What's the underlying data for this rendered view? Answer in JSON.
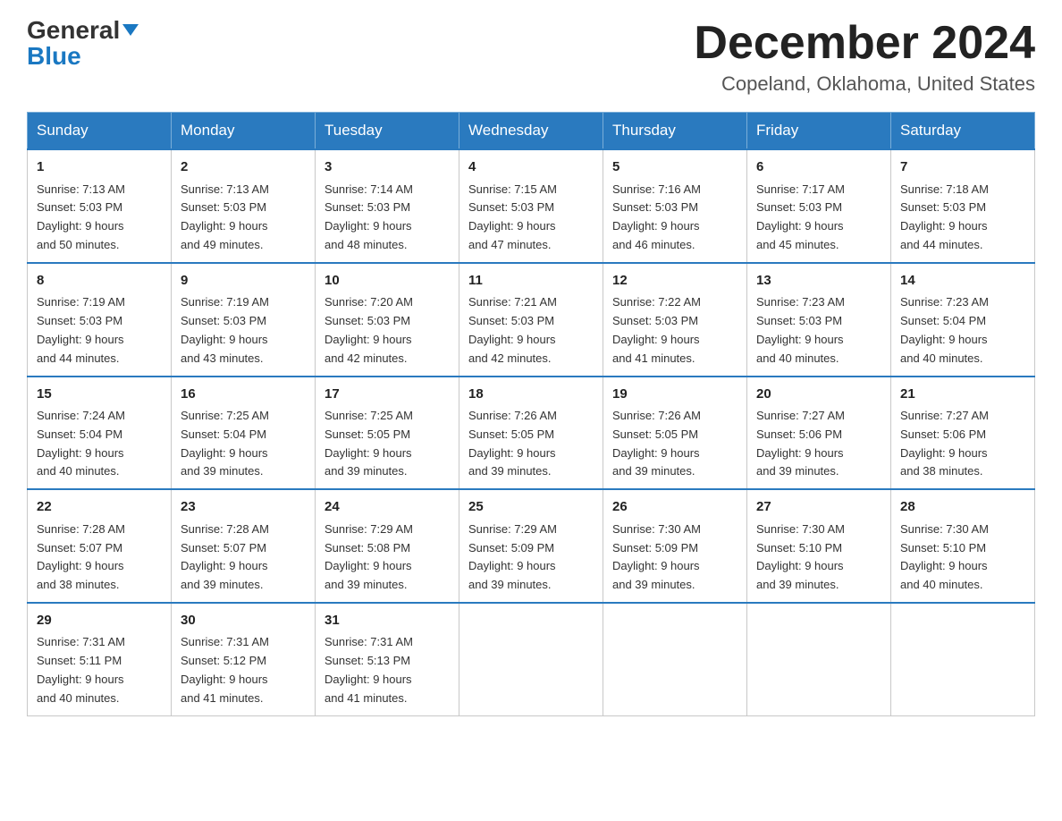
{
  "header": {
    "logo_line1": "General",
    "logo_line2": "Blue",
    "month_title": "December 2024",
    "location": "Copeland, Oklahoma, United States"
  },
  "weekdays": [
    "Sunday",
    "Monday",
    "Tuesday",
    "Wednesday",
    "Thursday",
    "Friday",
    "Saturday"
  ],
  "weeks": [
    [
      {
        "day": "1",
        "sunrise": "7:13 AM",
        "sunset": "5:03 PM",
        "daylight": "9 hours and 50 minutes."
      },
      {
        "day": "2",
        "sunrise": "7:13 AM",
        "sunset": "5:03 PM",
        "daylight": "9 hours and 49 minutes."
      },
      {
        "day": "3",
        "sunrise": "7:14 AM",
        "sunset": "5:03 PM",
        "daylight": "9 hours and 48 minutes."
      },
      {
        "day": "4",
        "sunrise": "7:15 AM",
        "sunset": "5:03 PM",
        "daylight": "9 hours and 47 minutes."
      },
      {
        "day": "5",
        "sunrise": "7:16 AM",
        "sunset": "5:03 PM",
        "daylight": "9 hours and 46 minutes."
      },
      {
        "day": "6",
        "sunrise": "7:17 AM",
        "sunset": "5:03 PM",
        "daylight": "9 hours and 45 minutes."
      },
      {
        "day": "7",
        "sunrise": "7:18 AM",
        "sunset": "5:03 PM",
        "daylight": "9 hours and 44 minutes."
      }
    ],
    [
      {
        "day": "8",
        "sunrise": "7:19 AM",
        "sunset": "5:03 PM",
        "daylight": "9 hours and 44 minutes."
      },
      {
        "day": "9",
        "sunrise": "7:19 AM",
        "sunset": "5:03 PM",
        "daylight": "9 hours and 43 minutes."
      },
      {
        "day": "10",
        "sunrise": "7:20 AM",
        "sunset": "5:03 PM",
        "daylight": "9 hours and 42 minutes."
      },
      {
        "day": "11",
        "sunrise": "7:21 AM",
        "sunset": "5:03 PM",
        "daylight": "9 hours and 42 minutes."
      },
      {
        "day": "12",
        "sunrise": "7:22 AM",
        "sunset": "5:03 PM",
        "daylight": "9 hours and 41 minutes."
      },
      {
        "day": "13",
        "sunrise": "7:23 AM",
        "sunset": "5:03 PM",
        "daylight": "9 hours and 40 minutes."
      },
      {
        "day": "14",
        "sunrise": "7:23 AM",
        "sunset": "5:04 PM",
        "daylight": "9 hours and 40 minutes."
      }
    ],
    [
      {
        "day": "15",
        "sunrise": "7:24 AM",
        "sunset": "5:04 PM",
        "daylight": "9 hours and 40 minutes."
      },
      {
        "day": "16",
        "sunrise": "7:25 AM",
        "sunset": "5:04 PM",
        "daylight": "9 hours and 39 minutes."
      },
      {
        "day": "17",
        "sunrise": "7:25 AM",
        "sunset": "5:05 PM",
        "daylight": "9 hours and 39 minutes."
      },
      {
        "day": "18",
        "sunrise": "7:26 AM",
        "sunset": "5:05 PM",
        "daylight": "9 hours and 39 minutes."
      },
      {
        "day": "19",
        "sunrise": "7:26 AM",
        "sunset": "5:05 PM",
        "daylight": "9 hours and 39 minutes."
      },
      {
        "day": "20",
        "sunrise": "7:27 AM",
        "sunset": "5:06 PM",
        "daylight": "9 hours and 39 minutes."
      },
      {
        "day": "21",
        "sunrise": "7:27 AM",
        "sunset": "5:06 PM",
        "daylight": "9 hours and 38 minutes."
      }
    ],
    [
      {
        "day": "22",
        "sunrise": "7:28 AM",
        "sunset": "5:07 PM",
        "daylight": "9 hours and 38 minutes."
      },
      {
        "day": "23",
        "sunrise": "7:28 AM",
        "sunset": "5:07 PM",
        "daylight": "9 hours and 39 minutes."
      },
      {
        "day": "24",
        "sunrise": "7:29 AM",
        "sunset": "5:08 PM",
        "daylight": "9 hours and 39 minutes."
      },
      {
        "day": "25",
        "sunrise": "7:29 AM",
        "sunset": "5:09 PM",
        "daylight": "9 hours and 39 minutes."
      },
      {
        "day": "26",
        "sunrise": "7:30 AM",
        "sunset": "5:09 PM",
        "daylight": "9 hours and 39 minutes."
      },
      {
        "day": "27",
        "sunrise": "7:30 AM",
        "sunset": "5:10 PM",
        "daylight": "9 hours and 39 minutes."
      },
      {
        "day": "28",
        "sunrise": "7:30 AM",
        "sunset": "5:10 PM",
        "daylight": "9 hours and 40 minutes."
      }
    ],
    [
      {
        "day": "29",
        "sunrise": "7:31 AM",
        "sunset": "5:11 PM",
        "daylight": "9 hours and 40 minutes."
      },
      {
        "day": "30",
        "sunrise": "7:31 AM",
        "sunset": "5:12 PM",
        "daylight": "9 hours and 41 minutes."
      },
      {
        "day": "31",
        "sunrise": "7:31 AM",
        "sunset": "5:13 PM",
        "daylight": "9 hours and 41 minutes."
      },
      null,
      null,
      null,
      null
    ]
  ],
  "labels": {
    "sunrise": "Sunrise:",
    "sunset": "Sunset:",
    "daylight": "Daylight:"
  }
}
